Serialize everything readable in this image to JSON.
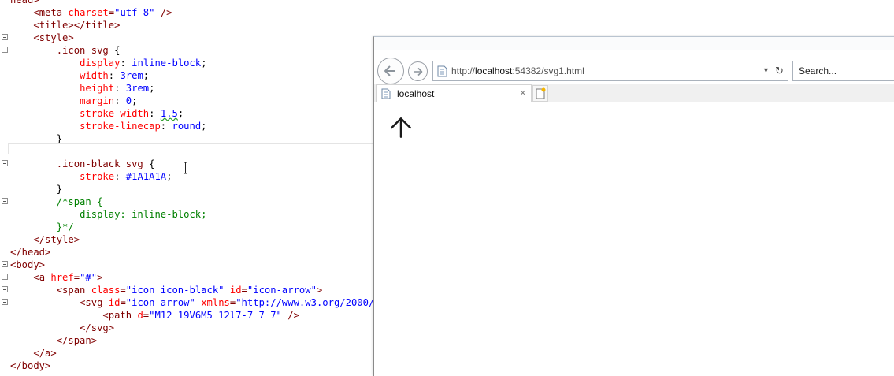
{
  "editor": {
    "lines": [
      [
        [
          "tag",
          "head>"
        ]
      ],
      [
        [
          "plain",
          "    "
        ],
        [
          "tag",
          "<meta "
        ],
        [
          "attr",
          "charset"
        ],
        [
          "tag",
          "="
        ],
        [
          "val",
          "\"utf-8\""
        ],
        [
          "tag",
          " />"
        ]
      ],
      [
        [
          "plain",
          "    "
        ],
        [
          "tag",
          "<title></title>"
        ]
      ],
      [
        [
          "plain",
          "    "
        ],
        [
          "tag",
          "<style>"
        ]
      ],
      [
        [
          "plain",
          "        "
        ],
        [
          "sel",
          ".icon svg "
        ],
        [
          "plain",
          "{"
        ]
      ],
      [
        [
          "plain",
          "            "
        ],
        [
          "prop",
          "display"
        ],
        [
          "plain",
          ": "
        ],
        [
          "val",
          "inline-block"
        ],
        [
          "plain",
          ";"
        ]
      ],
      [
        [
          "plain",
          "            "
        ],
        [
          "prop",
          "width"
        ],
        [
          "plain",
          ": "
        ],
        [
          "val",
          "3rem"
        ],
        [
          "plain",
          ";"
        ]
      ],
      [
        [
          "plain",
          "            "
        ],
        [
          "prop",
          "height"
        ],
        [
          "plain",
          ": "
        ],
        [
          "val",
          "3rem"
        ],
        [
          "plain",
          ";"
        ]
      ],
      [
        [
          "plain",
          "            "
        ],
        [
          "prop",
          "margin"
        ],
        [
          "plain",
          ": "
        ],
        [
          "val",
          "0"
        ],
        [
          "plain",
          ";"
        ]
      ],
      [
        [
          "plain",
          "            "
        ],
        [
          "prop",
          "stroke-width"
        ],
        [
          "plain",
          ": "
        ],
        [
          "valsq",
          "1.5"
        ],
        [
          "plain",
          ";"
        ]
      ],
      [
        [
          "plain",
          "            "
        ],
        [
          "prop",
          "stroke-linecap"
        ],
        [
          "plain",
          ": "
        ],
        [
          "val",
          "round"
        ],
        [
          "plain",
          ";"
        ]
      ],
      [
        [
          "plain",
          "        }"
        ]
      ],
      [
        [
          "plain",
          ""
        ]
      ],
      [
        [
          "plain",
          "        "
        ],
        [
          "sel",
          ".icon-black svg "
        ],
        [
          "plain",
          "{"
        ]
      ],
      [
        [
          "plain",
          "            "
        ],
        [
          "prop",
          "stroke"
        ],
        [
          "plain",
          ": "
        ],
        [
          "val",
          "#1A1A1A"
        ],
        [
          "plain",
          ";"
        ]
      ],
      [
        [
          "plain",
          "        }"
        ]
      ],
      [
        [
          "plain",
          "        "
        ],
        [
          "cmt",
          "/*span {"
        ]
      ],
      [
        [
          "plain",
          "            "
        ],
        [
          "cmt",
          "display: inline-block;"
        ]
      ],
      [
        [
          "plain",
          "        "
        ],
        [
          "cmt",
          "}*/"
        ]
      ],
      [
        [
          "plain",
          "    "
        ],
        [
          "tag",
          "</style>"
        ]
      ],
      [
        [
          "tag",
          "</head>"
        ]
      ],
      [
        [
          "tag",
          "<body>"
        ]
      ],
      [
        [
          "plain",
          "    "
        ],
        [
          "tag",
          "<a "
        ],
        [
          "attr",
          "href"
        ],
        [
          "tag",
          "="
        ],
        [
          "val",
          "\"#\""
        ],
        [
          "tag",
          ">"
        ]
      ],
      [
        [
          "plain",
          "        "
        ],
        [
          "tag",
          "<span "
        ],
        [
          "attr",
          "class"
        ],
        [
          "tag",
          "="
        ],
        [
          "val",
          "\"icon icon-black\""
        ],
        [
          "tag",
          " "
        ],
        [
          "attr",
          "id"
        ],
        [
          "tag",
          "="
        ],
        [
          "val",
          "\"icon-arrow\""
        ],
        [
          "tag",
          ">"
        ]
      ],
      [
        [
          "plain",
          "            "
        ],
        [
          "tag",
          "<svg "
        ],
        [
          "attr",
          "id"
        ],
        [
          "tag",
          "="
        ],
        [
          "val",
          "\"icon-arrow\""
        ],
        [
          "tag",
          " "
        ],
        [
          "attr",
          "xmlns"
        ],
        [
          "tag",
          "="
        ],
        [
          "link",
          "\"http://www.w3.org/2000/svg"
        ]
      ],
      [
        [
          "plain",
          "                "
        ],
        [
          "tag",
          "<path "
        ],
        [
          "attr",
          "d"
        ],
        [
          "tag",
          "="
        ],
        [
          "val",
          "\"M12 19V6M5 12l7-7 7 7\""
        ],
        [
          "tag",
          " />"
        ]
      ],
      [
        [
          "plain",
          "            "
        ],
        [
          "tag",
          "</svg>"
        ]
      ],
      [
        [
          "plain",
          "        "
        ],
        [
          "tag",
          "</span>"
        ]
      ],
      [
        [
          "plain",
          "    "
        ],
        [
          "tag",
          "</a>"
        ]
      ],
      [
        [
          "tag",
          "</body>"
        ]
      ]
    ],
    "fold_lines": [
      3,
      4,
      13,
      16,
      21,
      22,
      23,
      24
    ]
  },
  "browser": {
    "url_prefix": "http://",
    "url_host": "localhost",
    "url_rest": ":54382/svg1.html",
    "search_placeholder": "Search...",
    "tab_title": "localhost",
    "tab_close": "×",
    "dropdown_glyph": "▼",
    "refresh_glyph": "↻",
    "content_icon": "arrow-up-icon",
    "icon_stroke": "#1A1A1A"
  }
}
